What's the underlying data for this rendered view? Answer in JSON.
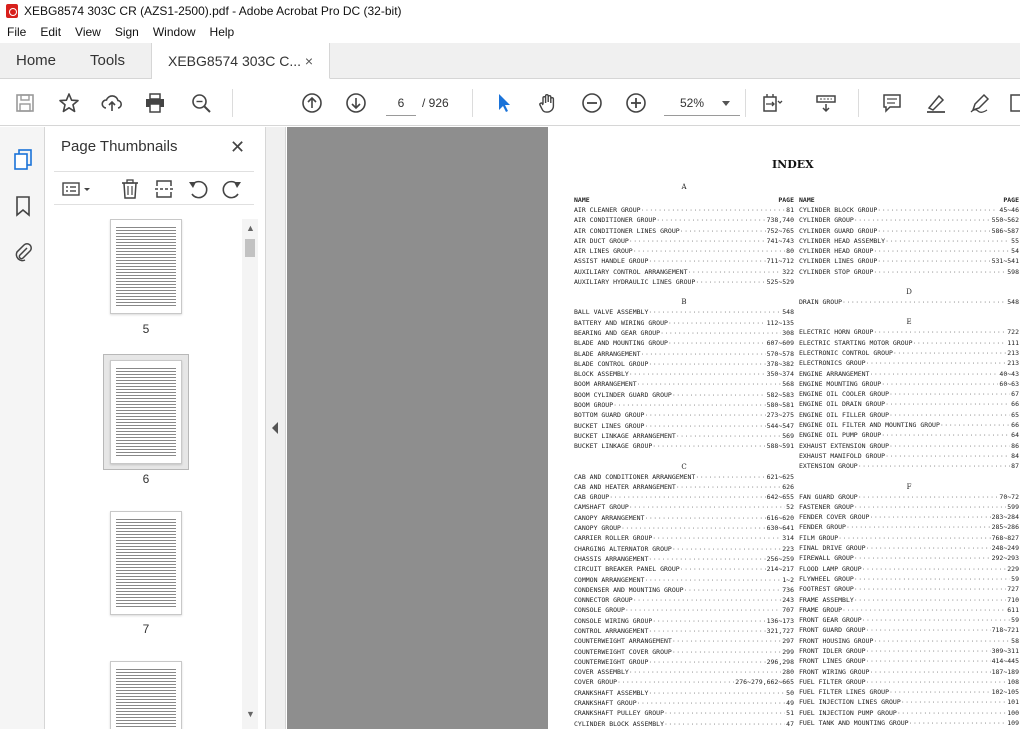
{
  "window": {
    "title": "XEBG8574 303C CR (AZS1-2500).pdf - Adobe Acrobat Pro DC (32-bit)"
  },
  "menu": [
    "File",
    "Edit",
    "View",
    "Sign",
    "Window",
    "Help"
  ],
  "tabs": {
    "home": "Home",
    "tools": "Tools",
    "doc": "XEBG8574 303C C...",
    "close": "×"
  },
  "toolbar": {
    "page_current": "6",
    "page_total": "/ 926",
    "zoom": "52%"
  },
  "thumbnails": {
    "title": "Page Thumbnails",
    "close": "✕",
    "pages": [
      "5",
      "6",
      "7"
    ]
  },
  "document": {
    "heading": "INDEX",
    "col_name_header": "NAME",
    "col_page_header": "PAGE",
    "left": [
      {
        "letter": "A",
        "entries": [
          [
            "AIR CLEANER GROUP",
            "81"
          ],
          [
            "AIR CONDITIONER GROUP",
            "738,740"
          ],
          [
            "AIR CONDITIONER LINES GROUP",
            "752~765"
          ],
          [
            "AIR DUCT GROUP",
            "741~743"
          ],
          [
            "AIR LINES GROUP",
            "80"
          ],
          [
            "ASSIST HANDLE GROUP",
            "711~712"
          ],
          [
            "AUXILIARY CONTROL ARRANGEMENT",
            "322"
          ],
          [
            "AUXILIARY HYDRAULIC LINES GROUP",
            "525~529"
          ]
        ]
      },
      {
        "letter": "B",
        "entries": [
          [
            "BALL VALVE ASSEMBLY",
            "548"
          ],
          [
            "BATTERY AND WIRING GROUP",
            "112~135"
          ],
          [
            "BEARING AND GEAR GROUP",
            "308"
          ],
          [
            "BLADE AND MOUNTING GROUP",
            "607~609"
          ],
          [
            "BLADE ARRANGEMENT",
            "570~578"
          ],
          [
            "BLADE CONTROL GROUP",
            "378~382"
          ],
          [
            "BLOCK ASSEMBLY",
            "350~374"
          ],
          [
            "BOOM ARRANGEMENT",
            "568"
          ],
          [
            "BOOM CYLINDER GUARD GROUP",
            "582~583"
          ],
          [
            "BOOM GROUP",
            "580~581"
          ],
          [
            "BOTTOM GUARD GROUP",
            "273~275"
          ],
          [
            "BUCKET LINES GROUP",
            "544~547"
          ],
          [
            "BUCKET LINKAGE ARRANGEMENT",
            "569"
          ],
          [
            "BUCKET LINKAGE GROUP",
            "588~591"
          ]
        ]
      },
      {
        "letter": "C",
        "entries": [
          [
            "CAB AND CONDITIONER ARRANGEMENT",
            "621~625"
          ],
          [
            "CAB AND HEATER ARRANGEMENT",
            "626"
          ],
          [
            "CAB GROUP",
            "642~655"
          ],
          [
            "CAMSHAFT GROUP",
            "52"
          ],
          [
            "CANOPY ARRANGEMENT",
            "616~620"
          ],
          [
            "CANOPY GROUP",
            "630~641"
          ],
          [
            "CARRIER ROLLER GROUP",
            "314"
          ],
          [
            "CHARGING ALTERNATOR GROUP",
            "223"
          ],
          [
            "CHASSIS ARRANGEMENT",
            "256~259"
          ],
          [
            "CIRCUIT BREAKER PANEL GROUP",
            "214~217"
          ],
          [
            "COMMON ARRANGEMENT",
            "1~2"
          ],
          [
            "CONDENSER AND MOUNTING GROUP",
            "736"
          ],
          [
            "CONNECTOR GROUP",
            "243"
          ],
          [
            "CONSOLE GROUP",
            "707"
          ],
          [
            "CONSOLE WIRING GROUP",
            "136~173"
          ],
          [
            "CONTROL ARRANGEMENT",
            "321,727"
          ],
          [
            "COUNTERWEIGHT ARRANGEMENT",
            "297"
          ],
          [
            "COUNTERWEIGHT COVER GROUP",
            "299"
          ],
          [
            "COUNTERWEIGHT GROUP",
            "296,298"
          ],
          [
            "COVER ASSEMBLY",
            "280"
          ],
          [
            "COVER GROUP",
            "276~279,662~665"
          ],
          [
            "CRANKSHAFT ASSEMBLY",
            "50"
          ],
          [
            "CRANKSHAFT GROUP",
            "49"
          ],
          [
            "CRANKSHAFT PULLEY GROUP",
            "51"
          ],
          [
            "CYLINDER BLOCK ASSEMBLY",
            "47"
          ]
        ]
      }
    ],
    "right": [
      {
        "letter": "",
        "entries": [
          [
            "CYLINDER BLOCK GROUP",
            "45~46"
          ],
          [
            "CYLINDER GROUP",
            "550~562"
          ],
          [
            "CYLINDER GUARD GROUP",
            "586~587"
          ],
          [
            "CYLINDER HEAD ASSEMBLY",
            "55"
          ],
          [
            "CYLINDER HEAD GROUP",
            "54"
          ],
          [
            "CYLINDER LINES GROUP",
            "531~541"
          ],
          [
            "CYLINDER STOP GROUP",
            "598"
          ]
        ]
      },
      {
        "letter": "D",
        "entries": [
          [
            "DRAIN GROUP",
            "548"
          ]
        ]
      },
      {
        "letter": "E",
        "entries": [
          [
            "ELECTRIC HORN GROUP",
            "722"
          ],
          [
            "ELECTRIC STARTING MOTOR GROUP",
            "111"
          ],
          [
            "ELECTRONIC CONTROL GROUP",
            "213"
          ],
          [
            "ELECTRONICS GROUP",
            "213"
          ],
          [
            "ENGINE ARRANGEMENT",
            "40~43"
          ],
          [
            "ENGINE MOUNTING GROUP",
            "60~63"
          ],
          [
            "ENGINE OIL COOLER GROUP",
            "67"
          ],
          [
            "ENGINE OIL DRAIN GROUP",
            "66"
          ],
          [
            "ENGINE OIL FILLER GROUP",
            "65"
          ],
          [
            "ENGINE OIL FILTER AND MOUNTING GROUP",
            "66"
          ],
          [
            "ENGINE OIL PUMP GROUP",
            "64"
          ],
          [
            "EXHAUST EXTENSION GROUP",
            "86"
          ],
          [
            "EXHAUST MANIFOLD GROUP",
            "84"
          ],
          [
            "EXTENSION GROUP",
            "87"
          ]
        ]
      },
      {
        "letter": "F",
        "entries": [
          [
            "FAN GUARD GROUP",
            "70~72"
          ],
          [
            "FASTENER GROUP",
            "599"
          ],
          [
            "FENDER COVER GROUP",
            "283~284"
          ],
          [
            "FENDER GROUP",
            "285~286"
          ],
          [
            "FILM GROUP",
            "768~827"
          ],
          [
            "FINAL DRIVE GROUP",
            "248~249"
          ],
          [
            "FIREWALL GROUP",
            "292~293"
          ],
          [
            "FLOOD LAMP GROUP",
            "229"
          ],
          [
            "FLYWHEEL GROUP",
            "59"
          ],
          [
            "FOOTREST GROUP",
            "727"
          ],
          [
            "FRAME ASSEMBLY",
            "710"
          ],
          [
            "FRAME GROUP",
            "611"
          ],
          [
            "FRONT GEAR GROUP",
            "59"
          ],
          [
            "FRONT GUARD GROUP",
            "718~721"
          ],
          [
            "FRONT HOUSING GROUP",
            "58"
          ],
          [
            "FRONT IDLER GROUP",
            "309~311"
          ],
          [
            "FRONT LINES GROUP",
            "414~445"
          ],
          [
            "FRONT WIRING GROUP",
            "187~189"
          ],
          [
            "FUEL FILTER GROUP",
            "108"
          ],
          [
            "FUEL FILTER LINES GROUP",
            "102~105"
          ],
          [
            "FUEL INJECTION LINES GROUP",
            "101"
          ],
          [
            "FUEL INJECTION PUMP GROUP",
            "100"
          ],
          [
            "FUEL TANK AND MOUNTING GROUP",
            "109"
          ]
        ]
      }
    ]
  }
}
